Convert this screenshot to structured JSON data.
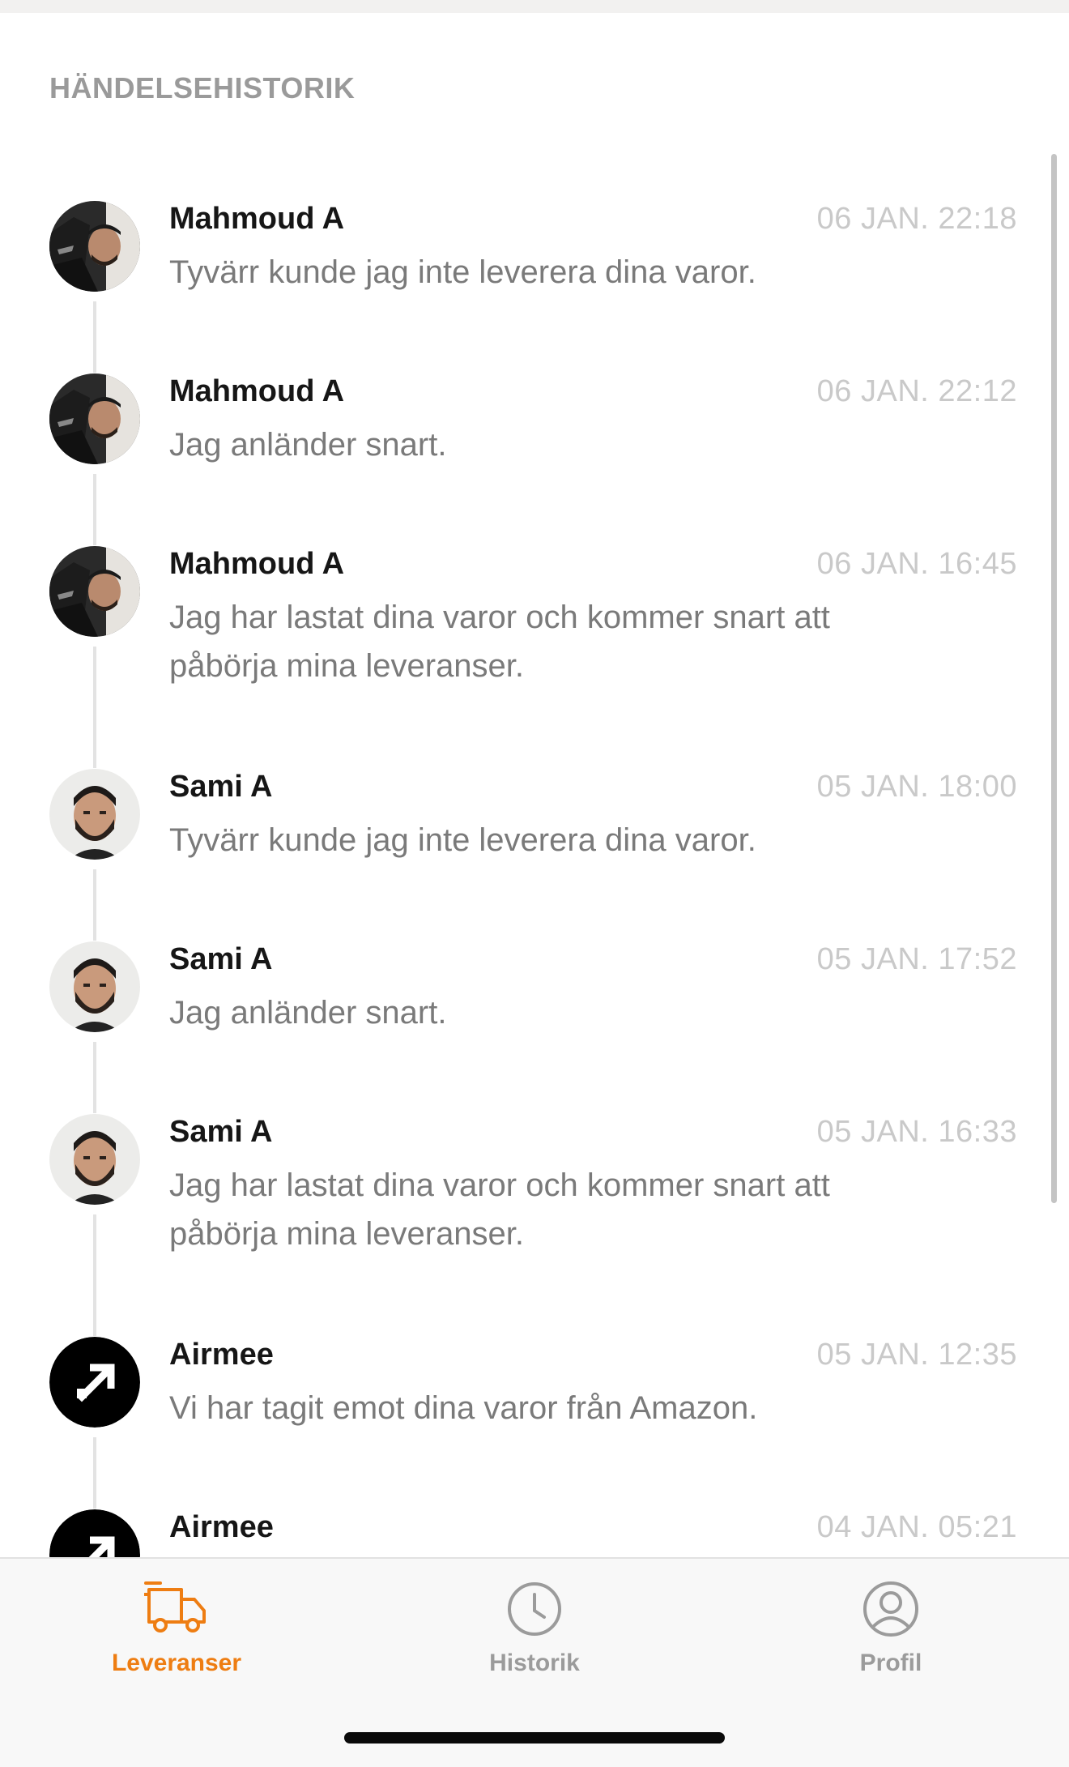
{
  "header": {
    "title": "HÄNDELSEHISTORIK"
  },
  "events": [
    {
      "name": "Mahmoud A",
      "time": "06 JAN. 22:18",
      "message": "Tyvärr kunde jag inte leverera dina varor.",
      "avatar": "photo-mahmoud"
    },
    {
      "name": "Mahmoud A",
      "time": "06 JAN. 22:12",
      "message": "Jag anländer snart.",
      "avatar": "photo-mahmoud"
    },
    {
      "name": "Mahmoud A",
      "time": "06 JAN. 16:45",
      "message": "Jag har lastat dina varor och kommer snart att påbörja mina leveranser.",
      "avatar": "photo-mahmoud"
    },
    {
      "name": "Sami A",
      "time": "05 JAN. 18:00",
      "message": "Tyvärr kunde jag inte leverera dina varor.",
      "avatar": "photo-sami"
    },
    {
      "name": "Sami A",
      "time": "05 JAN. 17:52",
      "message": "Jag anländer snart.",
      "avatar": "photo-sami"
    },
    {
      "name": "Sami A",
      "time": "05 JAN. 16:33",
      "message": "Jag har lastat dina varor och kommer snart att påbörja mina leveranser.",
      "avatar": "photo-sami"
    },
    {
      "name": "Airmee",
      "time": "05 JAN. 12:35",
      "message": "Vi har tagit emot dina varor från Amazon.",
      "avatar": "airmee-logo-icon"
    },
    {
      "name": "Airmee",
      "time": "04 JAN. 05:21",
      "message": "",
      "avatar": "airmee-logo-icon"
    }
  ],
  "tabbar": {
    "tabs": [
      {
        "label": "Leveranser",
        "icon": "truck-icon",
        "active": true
      },
      {
        "label": "Historik",
        "icon": "clock-icon",
        "active": false
      },
      {
        "label": "Profil",
        "icon": "profile-icon",
        "active": false
      }
    ]
  },
  "colors": {
    "accent": "#ee7d12",
    "title": "#9a9a9a",
    "name": "#161616",
    "message": "#7a7a7a",
    "time": "#c9c9c9",
    "inactive_tab": "#9b9b9b"
  }
}
